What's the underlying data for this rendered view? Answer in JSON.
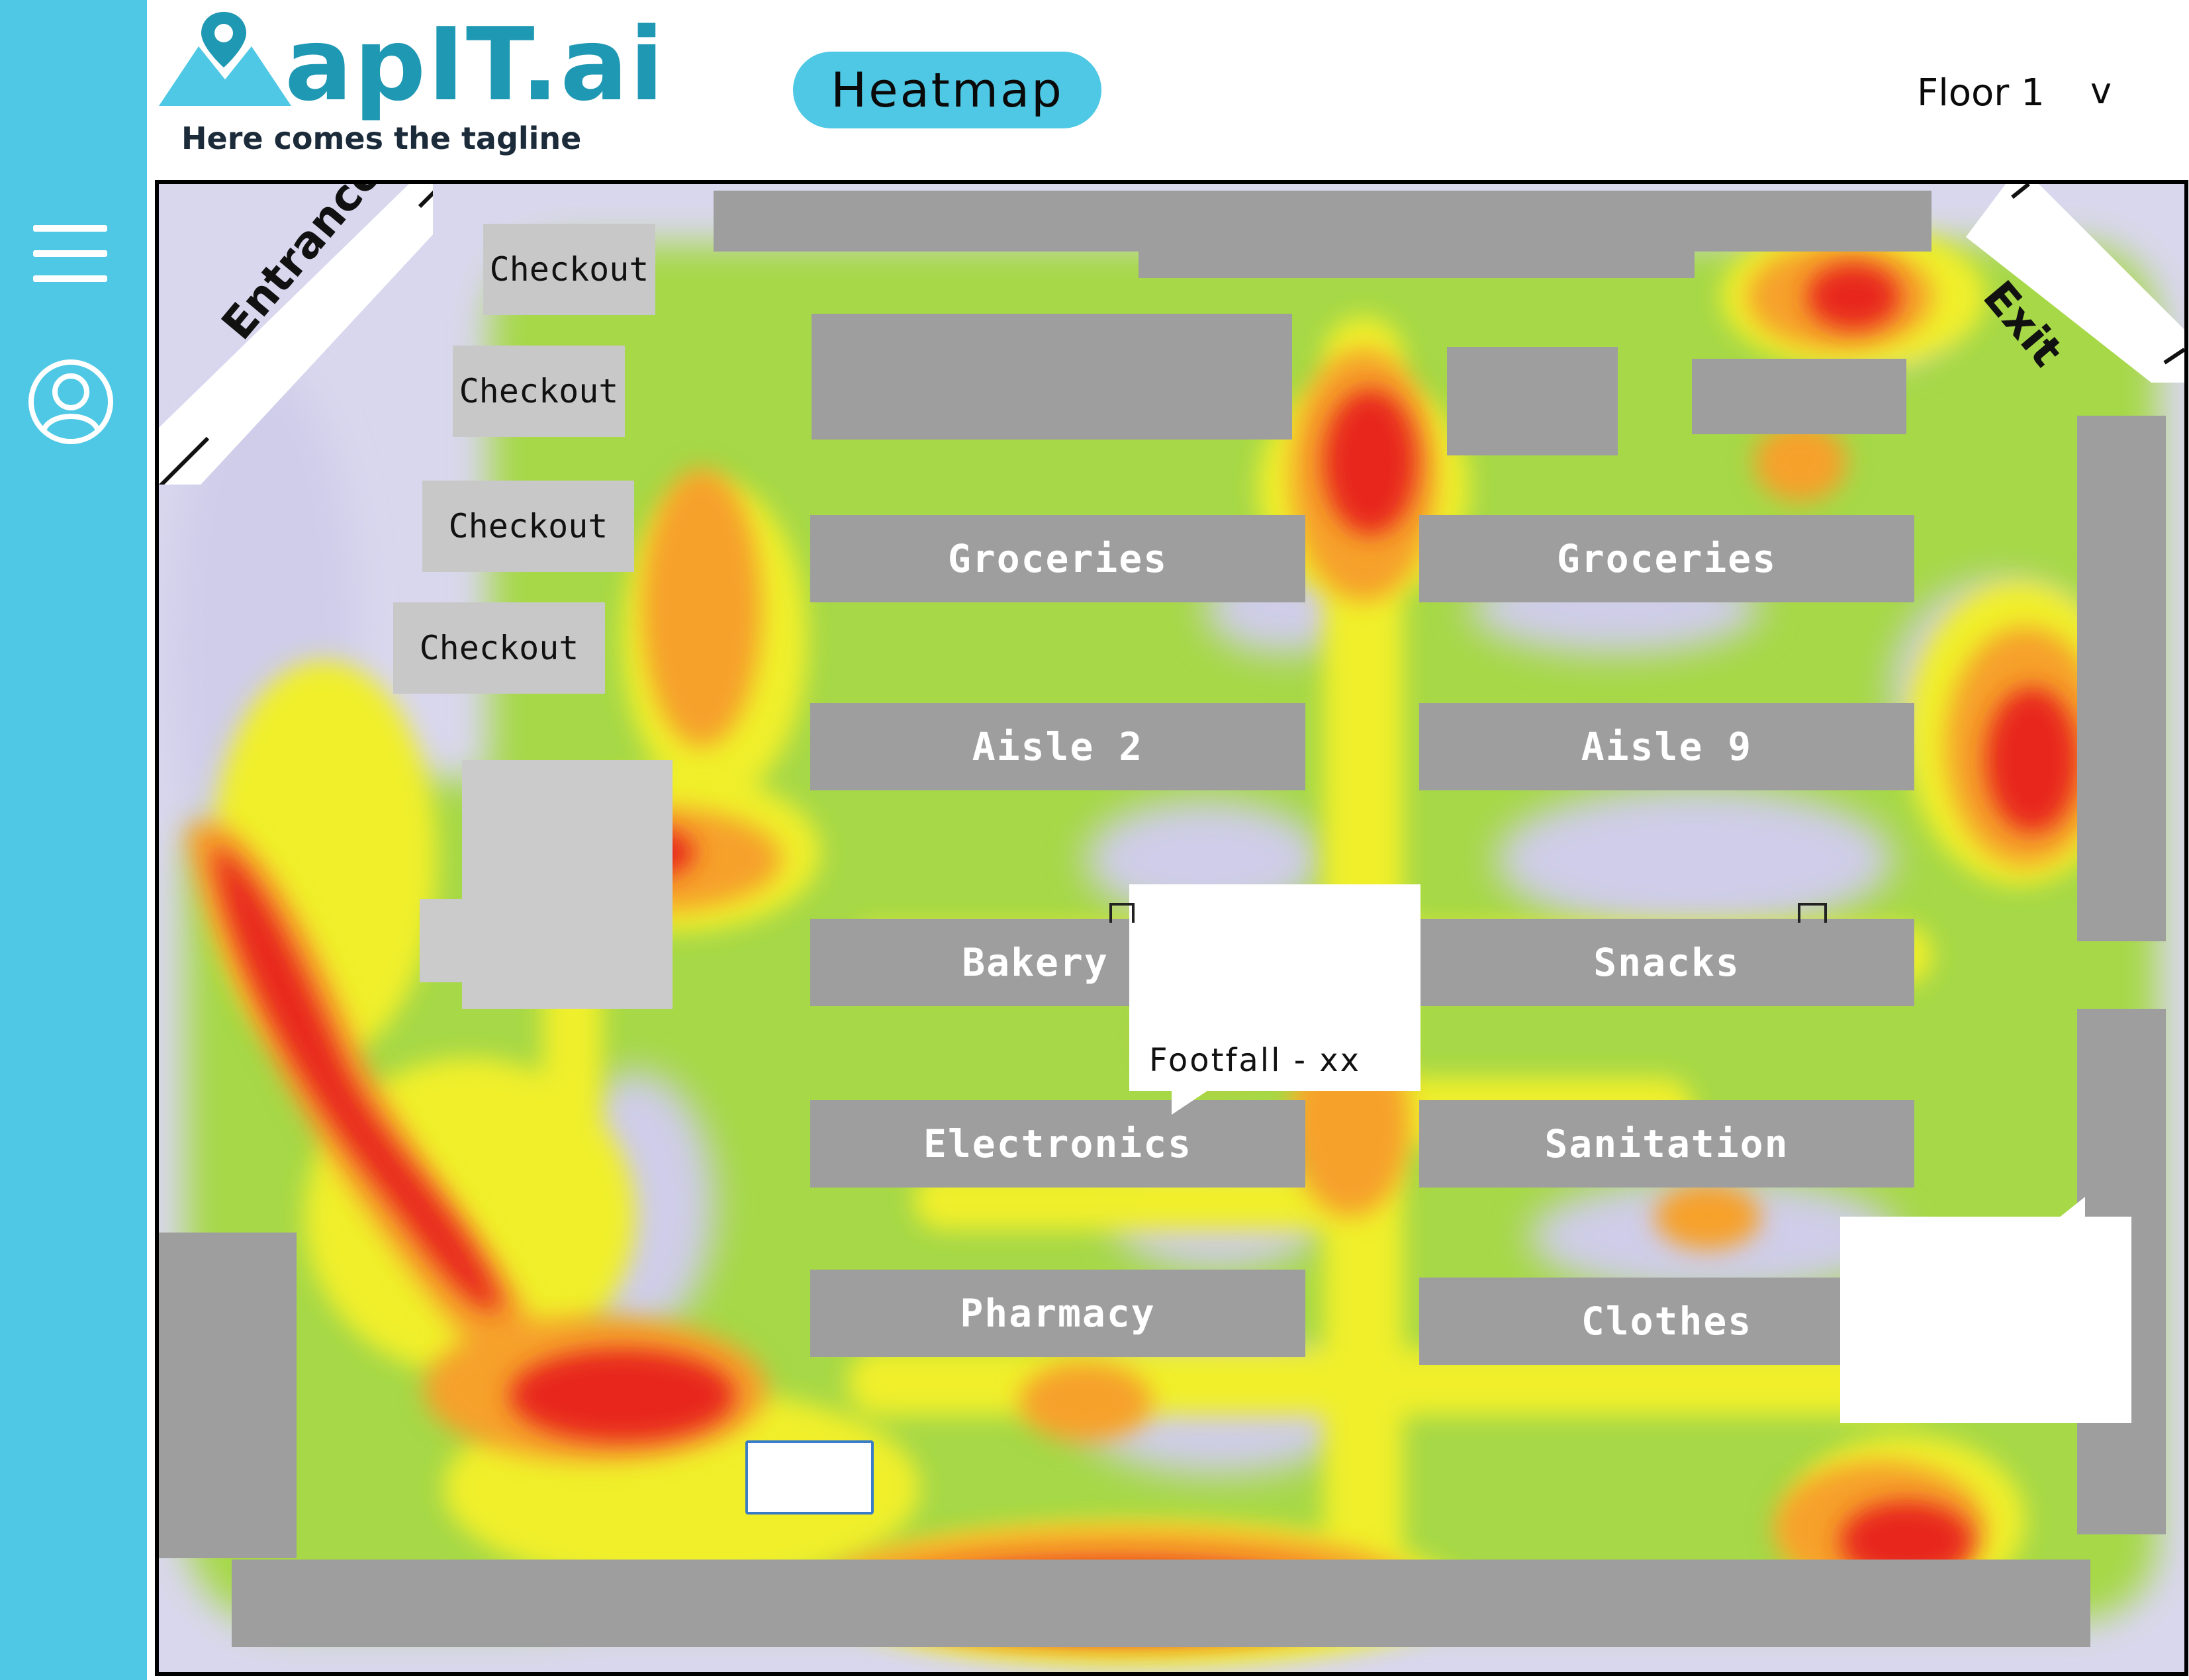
{
  "brand": {
    "name": "apIT.ai",
    "tagline": "Here comes the tagline",
    "color": "#1f98b3"
  },
  "sidebar": {
    "color": "#4ec8e4",
    "items": [
      {
        "icon": "hamburger-menu-icon"
      },
      {
        "icon": "user-profile-icon"
      }
    ]
  },
  "header": {
    "mode_label": "Heatmap",
    "floor_label": "Floor 1",
    "floor_chevron": "v"
  },
  "map": {
    "entrance_label": "Entrance",
    "exit_label": "Exit",
    "checkouts": [
      "Checkout",
      "Checkout",
      "Checkout",
      "Checkout"
    ],
    "aisles": {
      "groceries_left": "Groceries",
      "groceries_right": "Groceries",
      "aisle_2": "Aisle 2",
      "aisle_9": "Aisle 9",
      "bakery": "Bakery",
      "snacks": "Snacks",
      "electronics": "Electronics",
      "sanitation": "Sanitation",
      "pharmacy": "Pharmacy",
      "clothes": "Clothes"
    },
    "tooltip": {
      "text": "Footfall - xx"
    },
    "heat_colors": {
      "low": "#c9c9e8",
      "mid": "#9fd63a",
      "warm": "#f0ef2a",
      "high": "#f6a12a",
      "peak": "#e8281e"
    }
  }
}
